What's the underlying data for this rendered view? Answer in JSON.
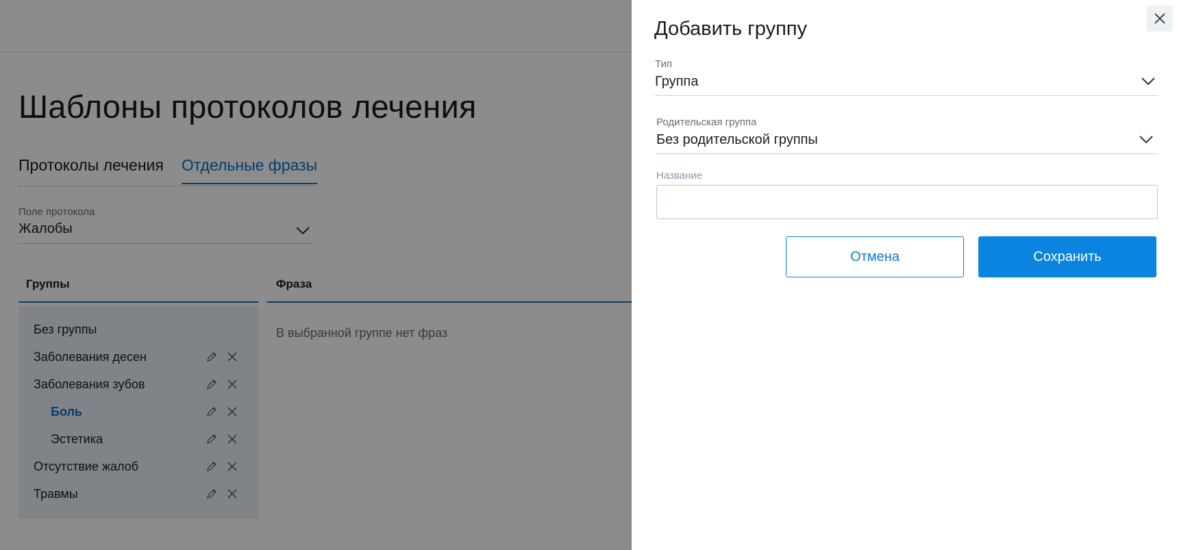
{
  "page": {
    "title": "Шаблоны протоколов лечения",
    "tabs": [
      {
        "label": "Протоколы лечения",
        "active": false
      },
      {
        "label": "Отдельные фразы",
        "active": true
      }
    ],
    "protocol_field": {
      "label": "Поле протокола",
      "value": "Жалобы"
    },
    "columns": {
      "groups": "Группы",
      "phrase": "Фраза"
    },
    "groups": [
      {
        "label": "Без группы",
        "actions": false,
        "child": false,
        "selected": false
      },
      {
        "label": "Заболевания десен",
        "actions": true,
        "child": false,
        "selected": false
      },
      {
        "label": "Заболевания зубов",
        "actions": true,
        "child": false,
        "selected": false
      },
      {
        "label": "Боль",
        "actions": true,
        "child": true,
        "selected": true
      },
      {
        "label": "Эстетика",
        "actions": true,
        "child": true,
        "selected": false
      },
      {
        "label": "Отсутствие жалоб",
        "actions": true,
        "child": false,
        "selected": false
      },
      {
        "label": "Травмы",
        "actions": true,
        "child": false,
        "selected": false
      }
    ],
    "empty_message": "В выбранной группе нет фраз"
  },
  "drawer": {
    "title": "Добавить группу",
    "type_field": {
      "label": "Тип",
      "value": "Группа"
    },
    "parent_field": {
      "label": "Родительская группа",
      "value": "Без родительской группы"
    },
    "name_field": {
      "label": "Название",
      "value": ""
    },
    "cancel_label": "Отмена",
    "save_label": "Сохранить"
  },
  "icons": {
    "edit": "pencil-icon",
    "delete": "close-icon",
    "dropdown": "chevron-down-icon"
  },
  "colors": {
    "accent": "#0a84de",
    "link": "#0a6fc4",
    "overlay": "rgba(0,0,0,0.45)"
  }
}
